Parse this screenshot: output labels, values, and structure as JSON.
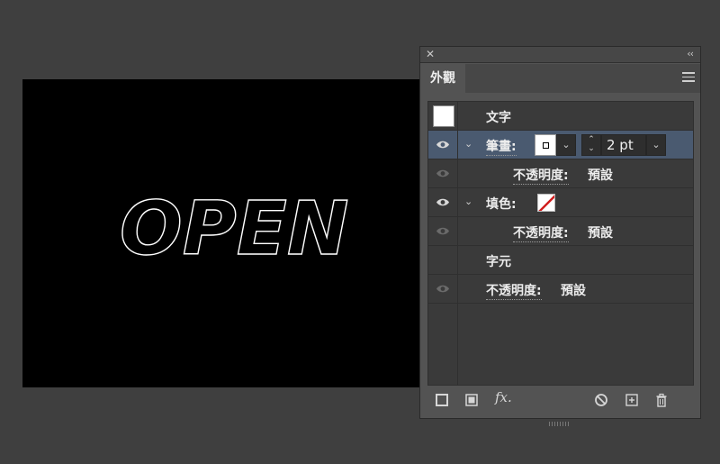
{
  "canvas": {
    "art_text": "OPEN"
  },
  "panel": {
    "close_glyph": "✕",
    "collapse_glyph": "‹‹",
    "tab_label": "外觀",
    "menu_icon": "hamburger-menu-icon",
    "rows": {
      "type_label": "文字",
      "stroke_label": "筆畫:",
      "stroke_weight": "2 pt",
      "stroke_opacity_label": "不透明度:",
      "stroke_opacity_value": "預設",
      "fill_label": "填色:",
      "fill_opacity_label": "不透明度:",
      "fill_opacity_value": "預設",
      "characters_label": "字元",
      "char_opacity_label": "不透明度:",
      "char_opacity_value": "預設"
    },
    "footer": {
      "fx_label": "fx."
    }
  },
  "colors": {
    "selected_row": "#4a5a70",
    "fill_none_slash": "#d01c1c"
  }
}
